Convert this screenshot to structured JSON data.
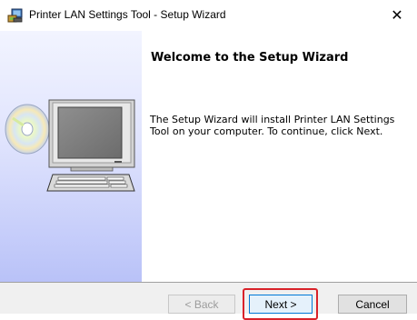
{
  "window": {
    "title": "Printer LAN Settings Tool - Setup Wizard",
    "close_glyph": "✕"
  },
  "content": {
    "heading": "Welcome to the Setup Wizard",
    "description": "The Setup Wizard will install Printer LAN Settings Tool on your computer. To continue, click Next."
  },
  "buttons": {
    "back_label": "< Back",
    "next_label": "Next >",
    "cancel_label": "Cancel"
  },
  "icons": {
    "app": "installer-computer-icon",
    "illustration": "computer-with-cd-illustration"
  },
  "colors": {
    "highlight": "#d9222a",
    "focus_border": "#0078d7",
    "panel_gradient_bottom": "#b9c2f8"
  }
}
